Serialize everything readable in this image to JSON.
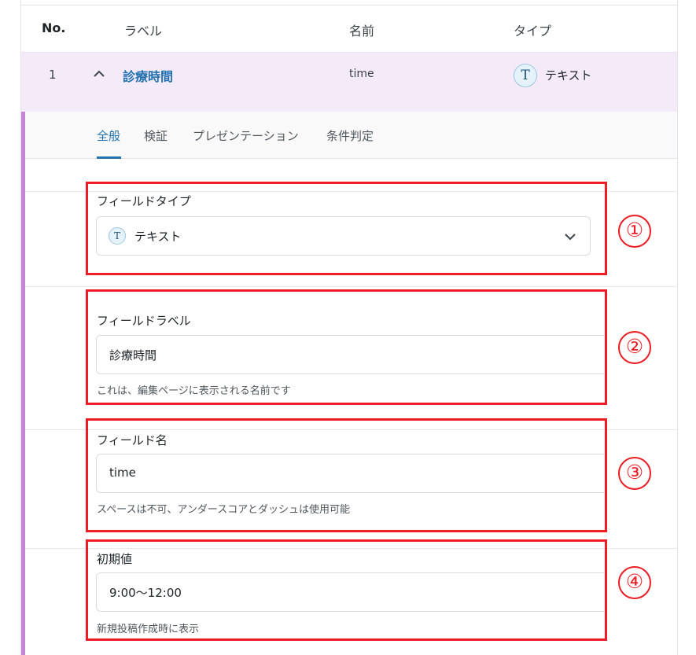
{
  "table_header": {
    "no": "No.",
    "label": "ラベル",
    "name": "名前",
    "type": "タイプ"
  },
  "field_row": {
    "no": "1",
    "label": "診療時間",
    "name": "time",
    "type_icon_letter": "T",
    "type": "テキスト"
  },
  "tabs": [
    "全般",
    "検証",
    "プレゼンテーション",
    "条件判定"
  ],
  "active_tab": "全般",
  "settings": {
    "field_type": {
      "label": "フィールドタイプ",
      "icon_letter": "T",
      "value": "テキスト"
    },
    "field_label": {
      "label": "フィールドラベル",
      "value": "診療時間",
      "help": "これは、編集ページに表示される名前です"
    },
    "field_name": {
      "label": "フィールド名",
      "value": "time",
      "help": "スペースは不可、アンダースコアとダッシュは使用可能"
    },
    "default_value": {
      "label": "初期値",
      "value": "9:00〜12:00",
      "help": "新規投稿作成時に表示"
    }
  },
  "annotations": [
    "①",
    "②",
    "③",
    "④"
  ],
  "colors": {
    "accent": "#c584d6",
    "row_bg": "#f5ebf8",
    "link": "#2271b1",
    "annotation_red": "#ee1c24"
  }
}
